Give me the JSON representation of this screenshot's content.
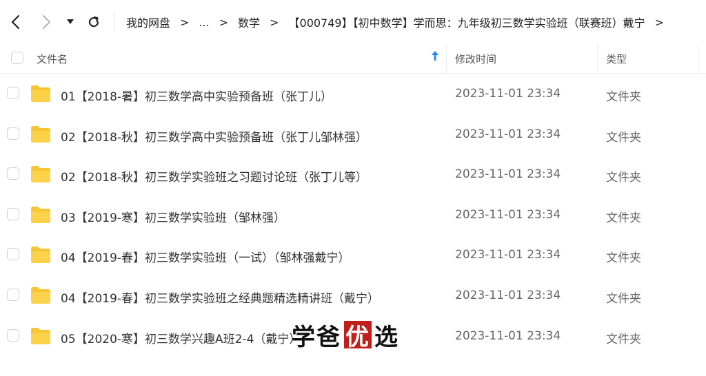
{
  "toolbar": {
    "back_icon": "arrow-left-icon",
    "forward_icon": "arrow-right-icon",
    "dropdown_icon": "caret-down-icon",
    "refresh_icon": "refresh-icon"
  },
  "breadcrumb": {
    "items": [
      "我的网盘",
      "...",
      "数学",
      "【000749】【初中数学】学而思：九年级初三数学实验班（联赛班）戴宁"
    ],
    "separator": ">"
  },
  "table": {
    "headers": {
      "name": "文件名",
      "time": "修改时间",
      "type": "类型"
    },
    "sort_icon": "arrow-up-icon",
    "sort_color": "#1f8bff",
    "folder_color": "#f7c531",
    "rows": [
      {
        "name": "01【2018-暑】初三数学高中实验预备班（张丁儿）",
        "time": "2023-11-01 23:34",
        "type": "文件夹"
      },
      {
        "name": "02【2018-秋】初三数学高中实验预备班（张丁儿邹林强）",
        "time": "2023-11-01 23:34",
        "type": "文件夹"
      },
      {
        "name": "02【2018-秋】初三数学实验班之习题讨论班（张丁儿等）",
        "time": "2023-11-01 23:34",
        "type": "文件夹"
      },
      {
        "name": "03【2019-寒】初三数学实验班（邹林强）",
        "time": "2023-11-01 23:34",
        "type": "文件夹"
      },
      {
        "name": "04【2019-春】初三数学实验班（一试）（邹林强戴宁）",
        "time": "2023-11-01 23:34",
        "type": "文件夹"
      },
      {
        "name": "04【2019-春】初三数学实验班之经典题精选精讲班（戴宁）",
        "time": "2023-11-01 23:34",
        "type": "文件夹"
      },
      {
        "name": "05【2020-寒】初三数学兴趣A班2-4（戴宁）",
        "time": "2023-11-01 23:34",
        "type": "文件夹"
      }
    ]
  },
  "watermark": {
    "part1": "学爸",
    "seal": "优",
    "part2": "选",
    "seal_color": "#c0201c"
  }
}
